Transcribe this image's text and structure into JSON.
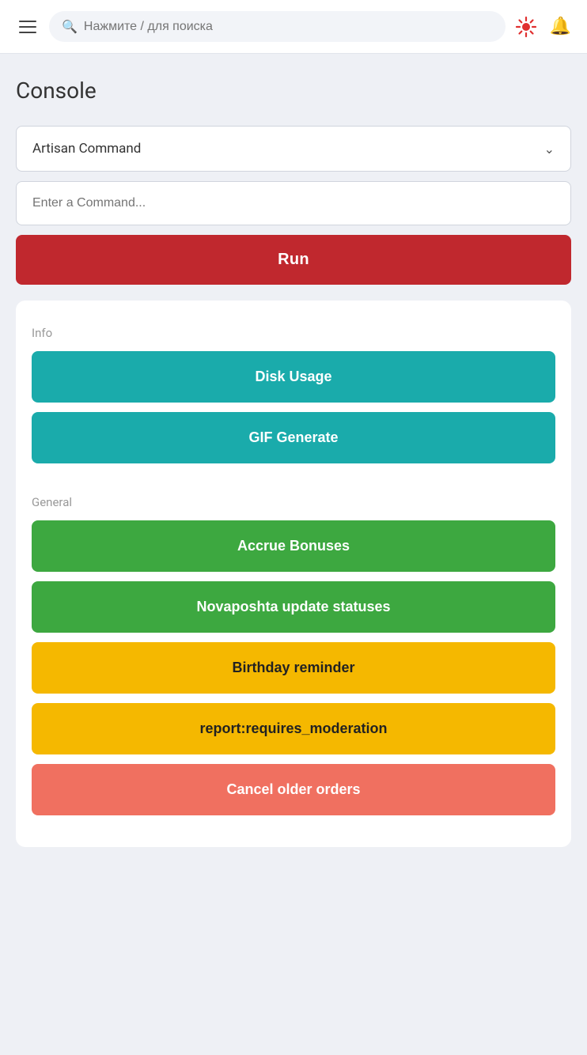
{
  "topnav": {
    "search_placeholder": "Нажмите / для поиска"
  },
  "page": {
    "title": "Console"
  },
  "artisan": {
    "dropdown_label": "Artisan Command",
    "command_placeholder": "Enter a Command..."
  },
  "run_button": {
    "label": "Run"
  },
  "sections": [
    {
      "label": "Info",
      "buttons": [
        {
          "id": "disk-usage",
          "label": "Disk Usage",
          "style": "teal"
        },
        {
          "id": "gif-generate",
          "label": "GIF Generate",
          "style": "teal"
        }
      ]
    },
    {
      "label": "General",
      "buttons": [
        {
          "id": "accrue-bonuses",
          "label": "Accrue Bonuses",
          "style": "green"
        },
        {
          "id": "novaposhta-update",
          "label": "Novaposhta update statuses",
          "style": "green"
        },
        {
          "id": "birthday-reminder",
          "label": "Birthday reminder",
          "style": "yellow"
        },
        {
          "id": "report-requires-moderation",
          "label": "report:requires_moderation",
          "style": "yellow"
        },
        {
          "id": "cancel-older-orders",
          "label": "Cancel older orders",
          "style": "salmon"
        }
      ]
    }
  ]
}
